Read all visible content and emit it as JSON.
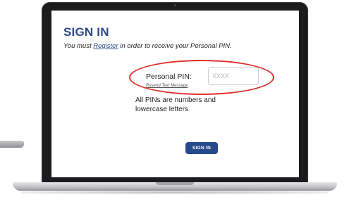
{
  "form": {
    "title": "SIGN IN",
    "instruction_before": "You must ",
    "register_link": "Register",
    "instruction_after": " in order to receive your Personal PIN.",
    "pin_label": "Personal PIN:",
    "resend_link": "Resend Text Message",
    "pin_placeholder": "XXXX",
    "pin_value": "",
    "hint": "All PINs are numbers and lowercase letters",
    "submit_label": "SIGN IN"
  },
  "colors": {
    "title": "#2a4a87",
    "button": "#274a8d",
    "highlight": "#e0302d",
    "bezel": "#1c1c1e"
  }
}
